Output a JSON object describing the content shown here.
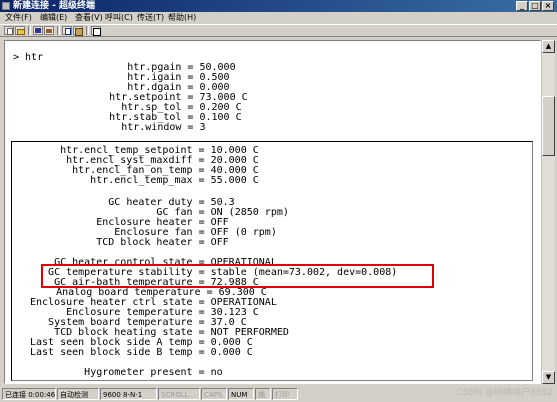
{
  "window": {
    "title": "新建连接 - 超级终端",
    "buttons": {
      "minimize": "_",
      "maximize": "□",
      "close": "×"
    }
  },
  "menu": [
    "文件(F)",
    "编辑(E)",
    "查看(V)",
    "呼叫(C)",
    "传送(T)",
    "帮助(H)"
  ],
  "toolbar": {
    "icons": [
      "new-document-icon",
      "open-folder-icon",
      "save-disk-icon",
      "call-phone-icon",
      "copy-icon",
      "paste-icon",
      "properties-icon"
    ]
  },
  "terminal": {
    "header_lines": [
      "> htr",
      "           htr.pgain = 50.000",
      "           htr.igain = 0.500",
      "           htr.dgain = 0.000",
      "        htr.setpoint = 73.000 C",
      "          htr.sp_tol = 0.200 C",
      "        htr.stab_tol = 0.100 C",
      "          htr.window = 3"
    ],
    "panel_lines": [
      "    htr.encl_temp_setpoint = 10.000 C",
      "     htr.encl_syst_maxdiff = 20.000 C",
      "      htr.encl_fan_on_temp = 40.000 C",
      "         htr.encl_temp_max = 55.000 C",
      "",
      "             GC heater duty = 50.3",
      "                     GC fan = ON (2850 rpm)",
      "           Enclosure heater = OFF",
      "              Enclosure fan = OFF (0 rpm)",
      "           TCD block heater = OFF",
      "",
      "    GC heater control state = OPERATIONAL",
      "   GC temperature stability = stable (mean=73.002, dev=0.008)",
      "    GC air-bath temperature = 72.988 C",
      "     Analog board temperature = 69.300 C",
      "Enclosure heater ctrl state = OPERATIONAL",
      "      Enclosure temperature = 30.123 C",
      "   System board temperature = 37.0 C",
      "    TCD block heating state = NOT PERFORMED",
      "Last seen block side A temp = 0.000 C",
      "Last seen block side B temp = 0.000 C",
      "",
      "         Hygrometer present = no"
    ]
  },
  "statusbar": {
    "connected": "已连接 0:00:46",
    "detect": "自动检测",
    "port": "9600 8-N-1",
    "scroll": "SCROLL",
    "caps": "CAPS",
    "num": "NUM",
    "capture": "捕",
    "print": "打印"
  },
  "watermark": "CSDN @网络用户8892"
}
